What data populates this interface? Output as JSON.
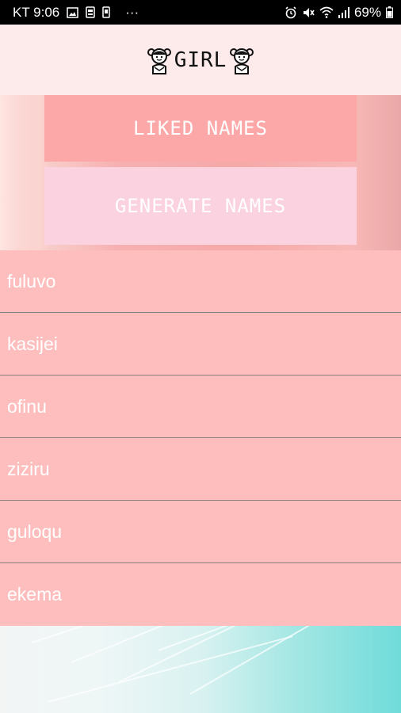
{
  "status_bar": {
    "carrier_time": "KT 9:06",
    "more": "···",
    "battery": "69%"
  },
  "header": {
    "title": "GIRL"
  },
  "buttons": {
    "liked": "LIKED NAMES",
    "generate": "GENERATE NAMES"
  },
  "names": [
    "fuluvo",
    "kasijei",
    "ofinu",
    "ziziru",
    "guloqu",
    "ekema"
  ],
  "colors": {
    "header_bg": "#fcebea",
    "liked_button": "#fca8a8",
    "generate_button": "#fbd2e0",
    "list_row": "#febebd"
  }
}
